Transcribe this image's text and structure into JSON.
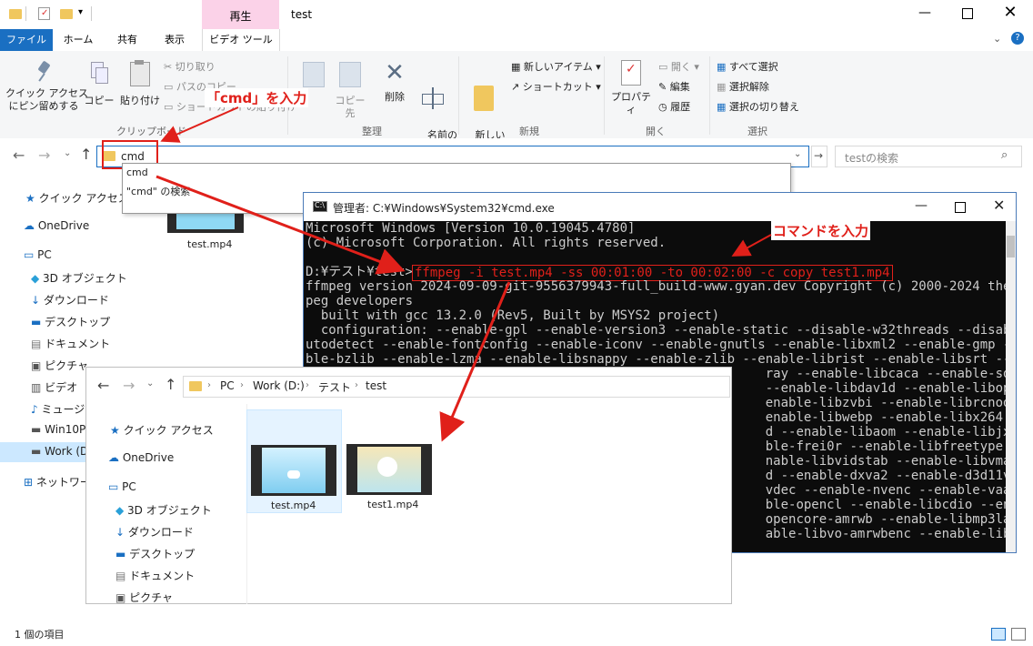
{
  "window": {
    "title": "test",
    "contextual_tab_group": "再生"
  },
  "ribbon_tabs": [
    {
      "label": "ファイル"
    },
    {
      "label": "ホーム"
    },
    {
      "label": "共有"
    },
    {
      "label": "表示"
    },
    {
      "label": "ビデオ ツール"
    }
  ],
  "ribbon": {
    "clipboard": {
      "pin": "クイック アクセス\nにピン留めする",
      "copy": "コピー",
      "paste": "貼り付け",
      "cut": "切り取り",
      "copy_path": "パスのコピー",
      "paste_shortcut": "ショートカットの貼り付け",
      "group": "クリップボード"
    },
    "organize": {
      "copy_to": "コピー先",
      "delete": "削除",
      "rename": "名前の\n変更",
      "group": "整理"
    },
    "new": {
      "new_folder": "新しい\nフォルダー",
      "new_item": "新しいアイテム",
      "shortcut": "ショートカット",
      "group": "新規"
    },
    "open": {
      "properties": "プロパティ",
      "open": "開く",
      "edit": "編集",
      "history": "履歴",
      "group": "開く"
    },
    "select": {
      "select_all": "すべて選択",
      "select_none": "選択解除",
      "invert": "選択の切り替え",
      "group": "選択"
    }
  },
  "address": {
    "value": "cmd",
    "search_placeholder": "testの検索"
  },
  "autocomplete": [
    "cmd",
    "\"cmd\" の検索"
  ],
  "nav_tree": [
    {
      "label": "クイック アクセス",
      "icon": "star-icon"
    },
    {
      "label": "OneDrive",
      "icon": "cloud-icon"
    },
    {
      "label": "PC",
      "icon": "pc-icon"
    },
    {
      "label": "3D オブジェクト",
      "icon": "cube-icon"
    },
    {
      "label": "ダウンロード",
      "icon": "download-icon"
    },
    {
      "label": "デスクトップ",
      "icon": "desktop-icon"
    },
    {
      "label": "ドキュメント",
      "icon": "document-icon"
    },
    {
      "label": "ピクチャ",
      "icon": "picture-icon"
    },
    {
      "label": "ビデオ",
      "icon": "video-icon"
    },
    {
      "label": "ミュージッ",
      "icon": "music-icon"
    },
    {
      "label": "Win10P",
      "icon": "drive-icon"
    },
    {
      "label": "Work (D",
      "icon": "drive-icon"
    },
    {
      "label": "ネットワーク",
      "icon": "network-icon"
    }
  ],
  "main_file": {
    "name": "test.mp4"
  },
  "status": {
    "count": "1 個の項目"
  },
  "callouts": {
    "cmd": "「cmd」を入力",
    "command": "コマンドを入力"
  },
  "cmd": {
    "title": "管理者: C:¥Windows¥System32¥cmd.exe",
    "lines": [
      "Microsoft Windows [Version 10.0.19045.4780]",
      "(c) Microsoft Corporation. All rights reserved.",
      "",
      "D:¥テスト¥test>",
      "ffmpeg version 2024-09-09-git-9556379943-full_build-www.gyan.dev Copyright (c) 2000-2024 the FFm",
      "peg developers",
      "  built with gcc 13.2.0 (Rev5, Built by MSYS2 project)",
      "  configuration: --enable-gpl --enable-version3 --enable-static --disable-w32threads --disable-a",
      "utodetect --enable-fontconfig --enable-iconv --enable-gnutls --enable-libxml2 --enable-gmp --ena",
      "ble-bzlib --enable-lzma --enable-libsnappy --enable-zlib --enable-librist --enable-libsrt --enab",
      "                                                            ray --enable-libcaca --enable-sdl2 --",
      "                                                            --enable-libdav1d --enable-libopenjp",
      "                                                            enable-libzvbi --enable-librcnode -",
      "                                                            enable-libwebp --enable-libx264 --enable",
      "                                                            d --enable-libaom --enable-libjxl --e",
      "                                                            ble-frei0r --enable-libfreetype --ena",
      "                                                            nable-libvidstab --enable-libvmaf --e",
      "                                                            d --enable-dxva2 --enable-d3d11va --e",
      "                                                            vdec --enable-nvenc --enable-vaapi --",
      "                                                            ble-opencl --enable-libcdio --enable-",
      "                                                            opencore-amrwb --enable-libmp3lame --",
      "                                                            able-libvo-amrwbenc --enable-libcodec"
    ],
    "command": "ffmpeg -i test.mp4 -ss 00:01:00 -to 00:02:00 -c copy test1.mp4"
  },
  "explorer2": {
    "breadcrumb": [
      "PC",
      "Work (D:)",
      "テスト",
      "test"
    ],
    "nav": [
      {
        "label": "クイック アクセス",
        "icon": "star-icon"
      },
      {
        "label": "OneDrive",
        "icon": "cloud-icon"
      },
      {
        "label": "PC",
        "icon": "pc-icon"
      },
      {
        "label": "3D オブジェクト",
        "icon": "cube-icon"
      },
      {
        "label": "ダウンロード",
        "icon": "download-icon"
      },
      {
        "label": "デスクトップ",
        "icon": "desktop-icon"
      },
      {
        "label": "ドキュメント",
        "icon": "document-icon"
      },
      {
        "label": "ピクチャ",
        "icon": "picture-icon"
      }
    ],
    "files": [
      {
        "name": "test.mp4"
      },
      {
        "name": "test1.mp4"
      }
    ]
  },
  "colors": {
    "accent": "#1a6fc2",
    "callout": "#e0201a",
    "contextual": "#fbd2e8",
    "console_bg": "#0c0c0c"
  }
}
